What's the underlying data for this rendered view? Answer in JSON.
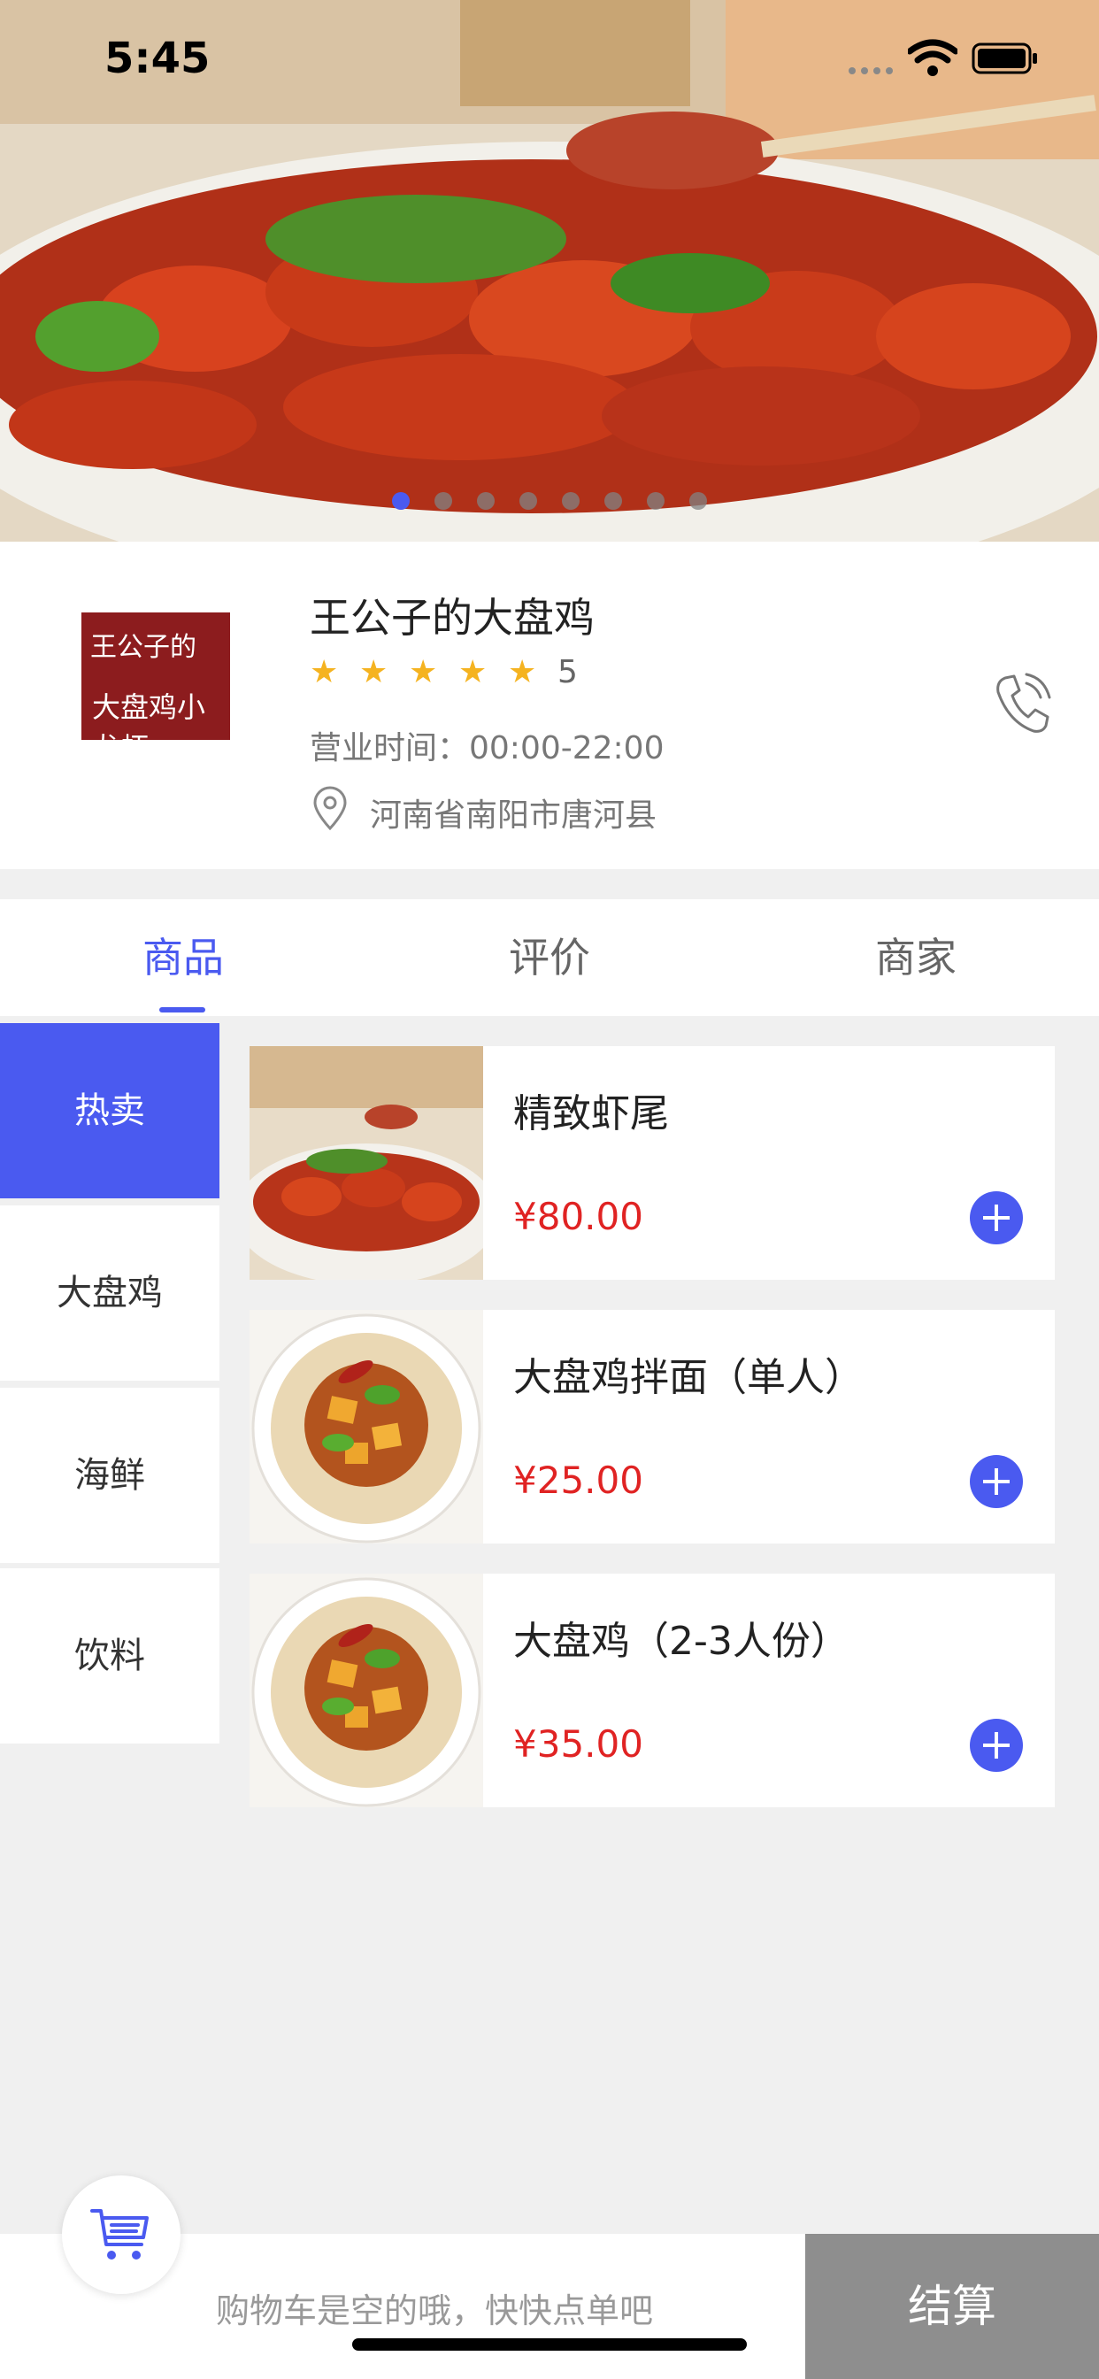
{
  "status_bar": {
    "time": "5:45"
  },
  "banner": {
    "slide_count": 8,
    "active_index": 0
  },
  "shop": {
    "logo_line1": "王公子的",
    "logo_line2": "大盘鸡小龙虾",
    "name": "王公子的大盘鸡",
    "rating": "5",
    "stars": 5,
    "hours": "营业时间：00:00-22:00",
    "address": "河南省南阳市唐河县",
    "icons": [
      "location-pin-icon",
      "phone-icon",
      "star-icon"
    ]
  },
  "tabs": [
    {
      "label": "商品",
      "active": true
    },
    {
      "label": "评价",
      "active": false
    },
    {
      "label": "商家",
      "active": false
    }
  ],
  "categories": [
    {
      "label": "热卖",
      "active": true
    },
    {
      "label": "大盘鸡",
      "active": false
    },
    {
      "label": "海鲜",
      "active": false
    },
    {
      "label": "饮料",
      "active": false
    }
  ],
  "products": [
    {
      "name": "精致虾尾",
      "price": "¥80.00"
    },
    {
      "name": "大盘鸡拌面（单人）",
      "price": "¥25.00"
    },
    {
      "name": "大盘鸡（2-3人份）",
      "price": "¥35.00"
    }
  ],
  "cart": {
    "empty_message": "购物车是空的哦，快快点单吧",
    "checkout_label": "结算"
  },
  "colors": {
    "accent": "#4a5af0",
    "price": "#e02323",
    "checkout_disabled": "#8e8e8e"
  }
}
